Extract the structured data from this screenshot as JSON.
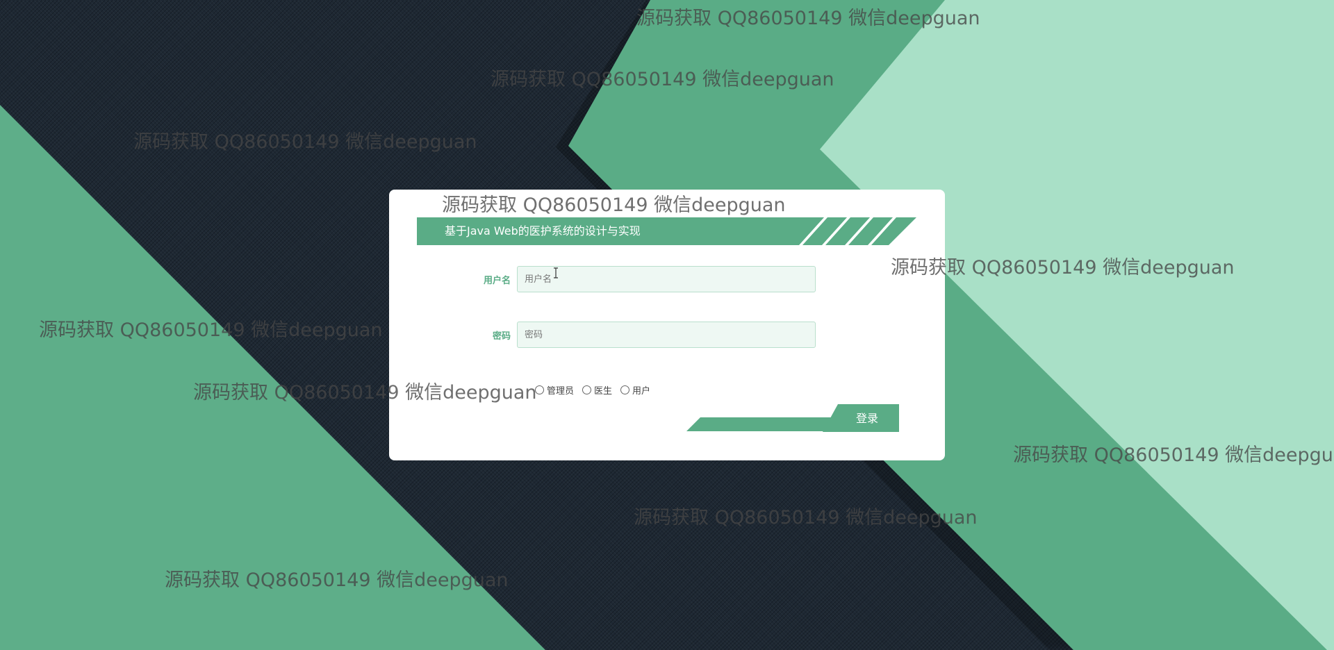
{
  "login": {
    "title": "基于Java Web的医护系统的设计与实现",
    "username": {
      "label": "用户名",
      "placeholder": "用户名",
      "value": ""
    },
    "password": {
      "label": "密码",
      "placeholder": "密码",
      "value": ""
    },
    "roles": [
      {
        "label": "管理员",
        "checked": false
      },
      {
        "label": "医生",
        "checked": false
      },
      {
        "label": "用户",
        "checked": false
      }
    ],
    "submit_label": "登录"
  },
  "watermark_text": "源码获取 QQ86050149 微信deepguan",
  "colors": {
    "accent": "#5aac86",
    "accent_light": "#a9e0c7",
    "background_dark": "#1e2833"
  }
}
